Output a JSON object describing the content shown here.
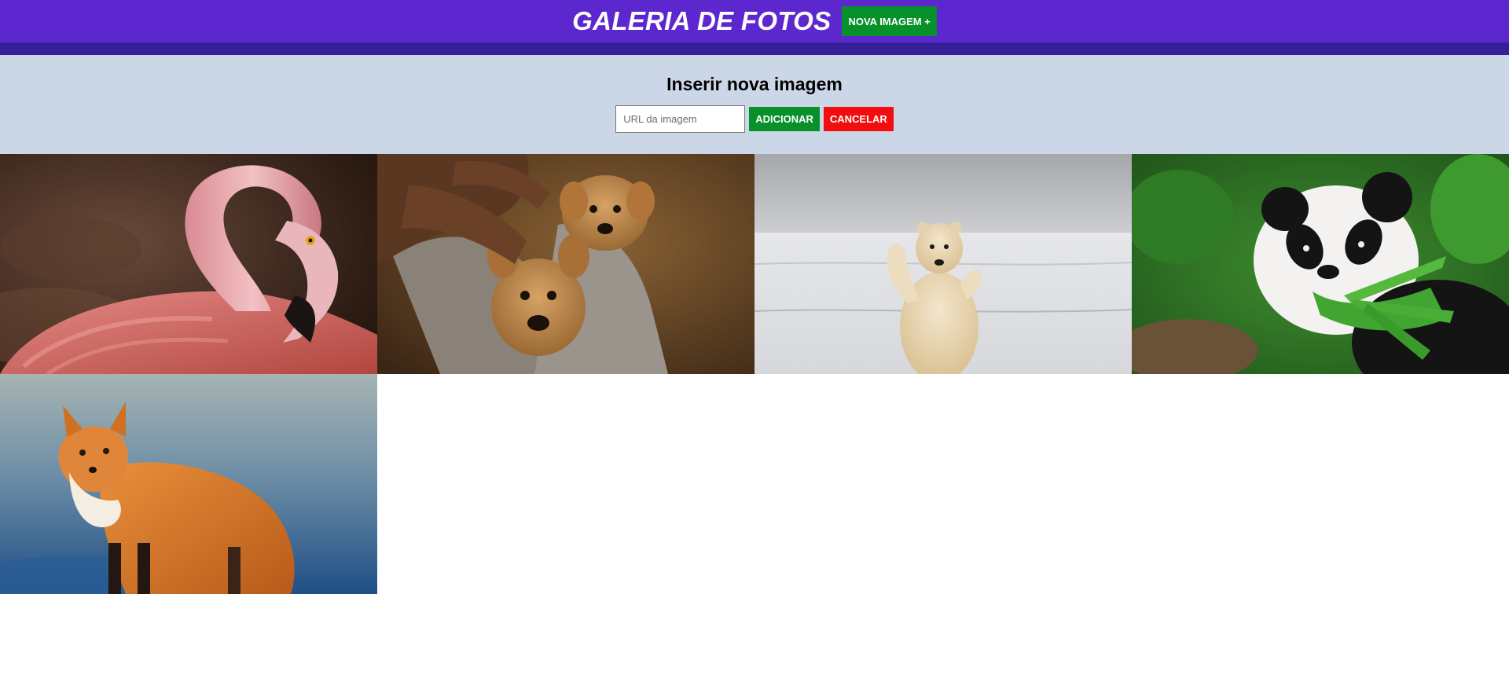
{
  "header": {
    "title": "GALERIA DE FOTOS",
    "new_image_button": "NOVA IMAGEM +",
    "colors": {
      "bar": "#5d27d0",
      "bar_shadow": "#35209a",
      "button": "#08912b"
    }
  },
  "form": {
    "title": "Inserir nova imagem",
    "url_placeholder": "URL da imagem",
    "url_value": "",
    "add_button": "ADICIONAR",
    "cancel_button": "CANCELAR",
    "colors": {
      "panel": "#cbd7e7",
      "add": "#08912b",
      "cancel": "#f20e0e"
    }
  },
  "gallery": {
    "photos": [
      {
        "subject": "flamingo"
      },
      {
        "subject": "puppies"
      },
      {
        "subject": "polar-bear"
      },
      {
        "subject": "panda"
      },
      {
        "subject": "fox"
      }
    ]
  }
}
